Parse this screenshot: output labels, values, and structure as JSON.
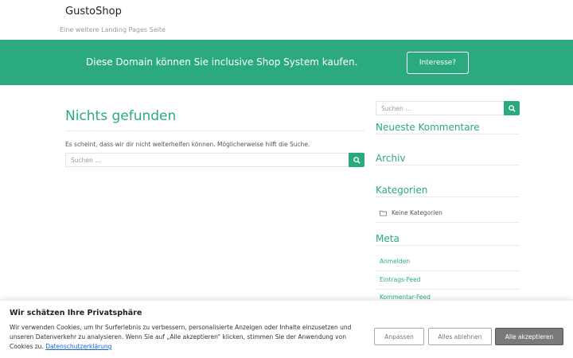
{
  "header": {
    "site_title": "GustoShop",
    "tagline": "Eine weitere Landing Pages Seite"
  },
  "banner": {
    "text": "Diese Domain können Sie inclusive Shop System kaufen.",
    "button_label": "Interesse?"
  },
  "main": {
    "title": "Nichts gefunden",
    "message": "Es scheint, dass wir dir nicht weiterhelfen können. Möglicherweise hilft die Suche.",
    "search_placeholder": "Suchen …"
  },
  "sidebar": {
    "search_placeholder": "Suchen …",
    "recent_comments_title": "Neueste Kommentare",
    "archive_title": "Archiv",
    "categories_title": "Kategorien",
    "no_categories": "Keine Kategorien",
    "meta_title": "Meta",
    "meta_links": [
      "Anmelden",
      "Eintrags-Feed",
      "Kommentar-Feed"
    ]
  },
  "cookie": {
    "title": "Wir schätzen Ihre Privatsphäre",
    "text": "Wir verwenden Cookies, um Ihr Surferlebnis zu verbessern, personalisierte Anzeigen oder Inhalte einzusetzen und unseren Datenverkehr zu analysieren. Wenn Sie auf „Alle akzeptieren“ klicken, stimmen Sie der Anwendung von Cookies zu.",
    "privacy_link": "Datenschutzerklärung",
    "customize_label": "Anpassen",
    "reject_label": "Alles ablehnen",
    "accept_label": "Alle akzeptieren"
  },
  "colors": {
    "accent": "#2baa7f",
    "link": "#1863dc",
    "accept_button": "#7a7a7a"
  },
  "icons": [
    "search-icon",
    "folder-icon"
  ]
}
